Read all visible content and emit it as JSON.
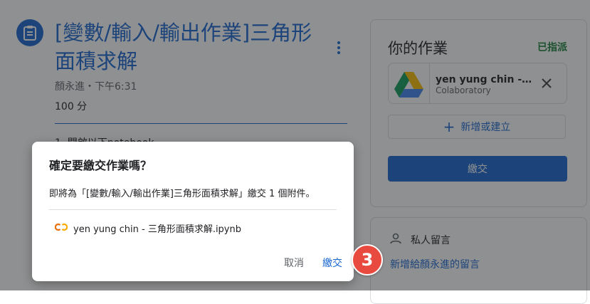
{
  "assignment": {
    "icon": "assignment-clipboard-icon",
    "title": "[變數/輸入/輸出作業]三角形面積求解",
    "meta": "顏永進・下午6:31",
    "points": "100 分",
    "description_partial": "1. 開啟以下notebook"
  },
  "your_work": {
    "title": "你的作業",
    "status": "已指派",
    "status_color": "#188038",
    "attachment": {
      "name": "yen yung chin - 三...",
      "type": "Colaboratory",
      "thumb_icon": "google-drive-icon"
    },
    "add_label": "新增或建立",
    "turn_in_label": "繳交"
  },
  "private_comments": {
    "title": "私人留言",
    "add_link": "新增給顏永進的留言"
  },
  "dialog": {
    "title": "確定要繳交作業嗎？",
    "body": "即將為「[變數/輸入/輸出作業]三角形面積求解」繳交 1 個附件。",
    "file_name": "yen yung chin - 三角形面積求解.ipynb",
    "file_icon": "colab-icon",
    "cancel_label": "取消",
    "confirm_label": "繳交"
  },
  "step_marker": "3",
  "colors": {
    "primary": "#1967d2",
    "marker": "#e94a3f"
  }
}
